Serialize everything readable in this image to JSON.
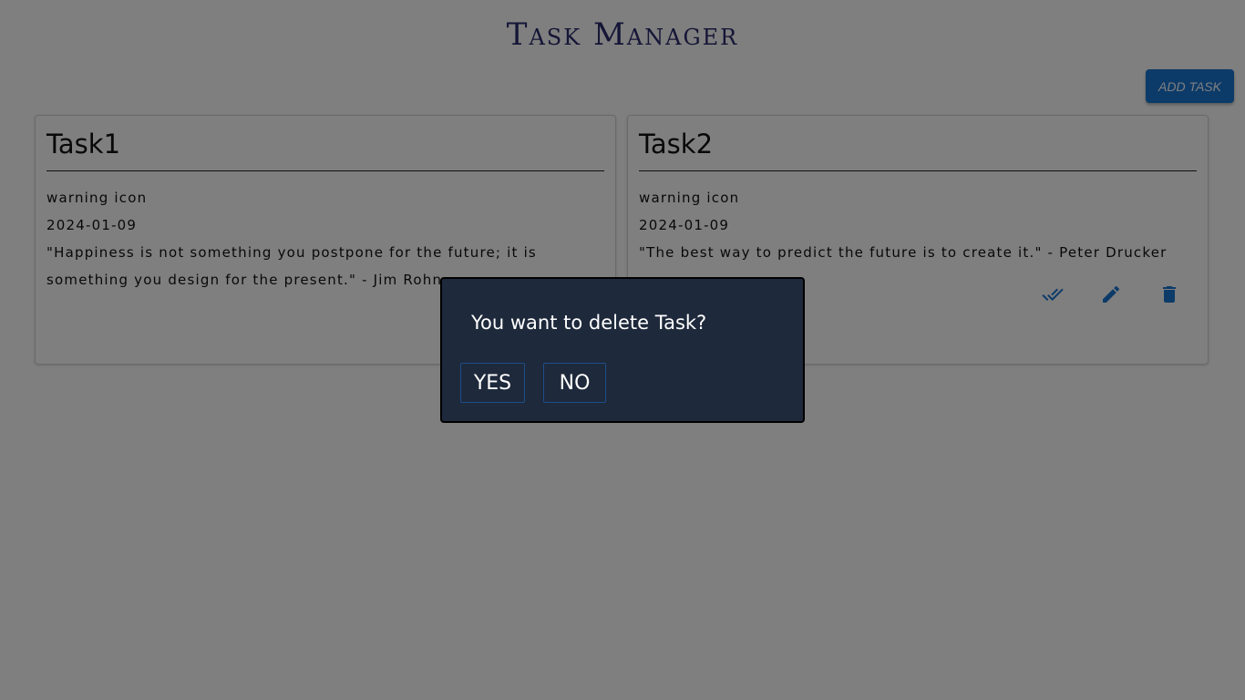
{
  "header": {
    "title": "Task Manager",
    "add_task_label": "ADD TASK"
  },
  "tasks": [
    {
      "title": "Task1",
      "priority": "warning icon",
      "date": "2024-01-09",
      "description": "\"Happiness is not something you postpone for the future; it is something you design for the present.\" - Jim Rohn"
    },
    {
      "title": "Task2",
      "priority": "warning icon",
      "date": "2024-01-09",
      "description": "\"The best way to predict the future is to create it.\" - Peter Drucker"
    }
  ],
  "task_actions": {
    "complete_icon": "done-all-icon",
    "edit_icon": "pencil-icon",
    "delete_icon": "trash-icon"
  },
  "dialog": {
    "message": "You want to delete Task?",
    "yes_label": "YES",
    "no_label": "NO"
  },
  "colors": {
    "primary": "#1976d2",
    "title": "#2a2a6e",
    "dialog_bg": "#1e293b",
    "overlay": "rgba(0,0,0,0.5)"
  }
}
